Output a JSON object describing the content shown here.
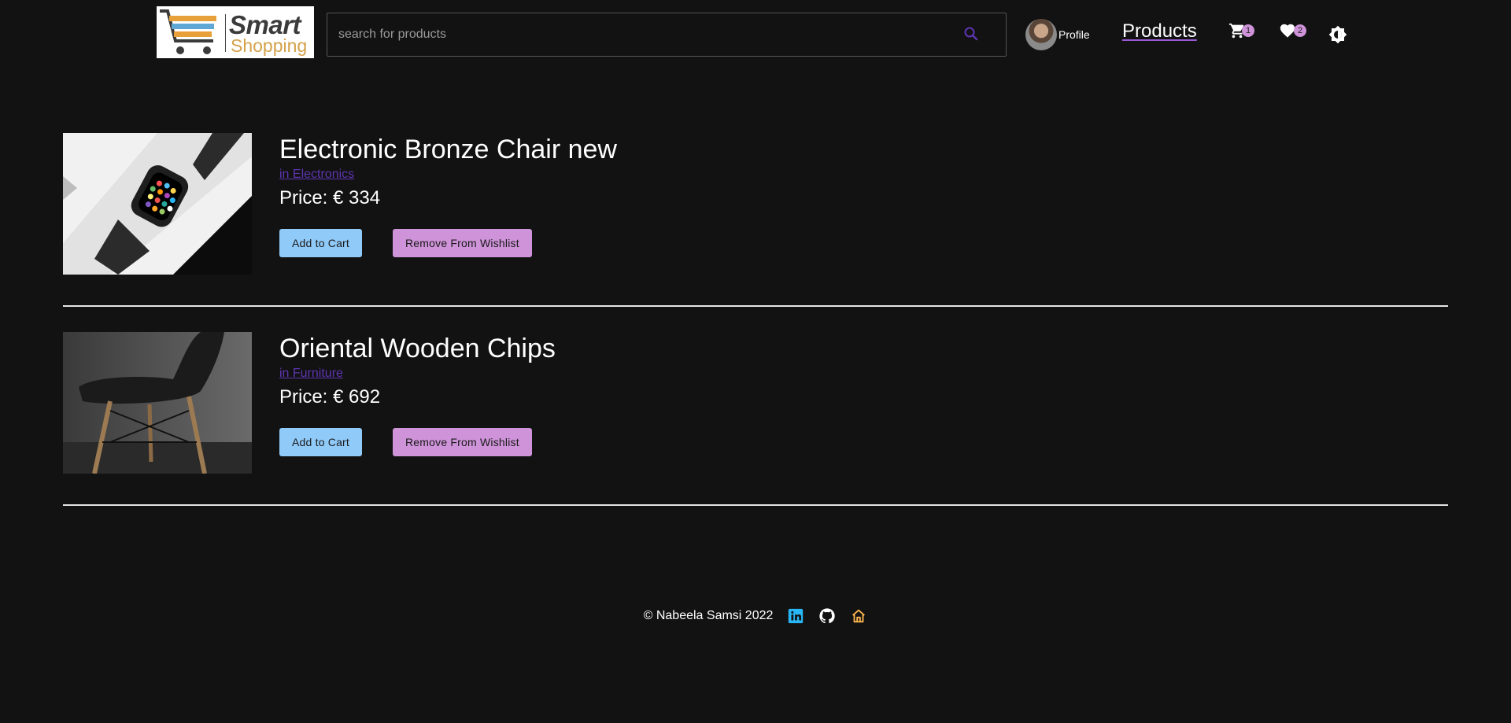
{
  "header": {
    "logo": {
      "word1": "Smart",
      "word2": "Shopping"
    },
    "search": {
      "placeholder": "search for products",
      "value": ""
    },
    "profile_label": "Profile",
    "nav_products": "Products",
    "cart_count": "1",
    "wishlist_count": "2",
    "icons": [
      "search-icon",
      "cart-icon",
      "heart-icon",
      "brightness-icon"
    ]
  },
  "wishlist": {
    "items": [
      {
        "title": "Electronic Bronze Chair new",
        "category": "in Electronics",
        "price": "Price: € 334",
        "add_to_cart": "Add to Cart",
        "remove": "Remove From Wishlist",
        "image": "smartwatch-photo"
      },
      {
        "title": "Oriental Wooden Chips",
        "category": "in Furniture",
        "price": "Price: € 692",
        "add_to_cart": "Add to Cart",
        "remove": "Remove From Wishlist",
        "image": "black-chair-photo"
      }
    ]
  },
  "footer": {
    "copyright": "© Nabeela Samsi 2022",
    "icons": [
      "linkedin-icon",
      "github-icon",
      "home-icon"
    ]
  },
  "colors": {
    "background": "#121212",
    "cart_button": "#90caf9",
    "wishlist_button": "#ce93d8",
    "badge": "#ce93d8",
    "category_link": "#5e35b1",
    "linkedin": "#29b6f6",
    "home": "#ffb74d"
  }
}
